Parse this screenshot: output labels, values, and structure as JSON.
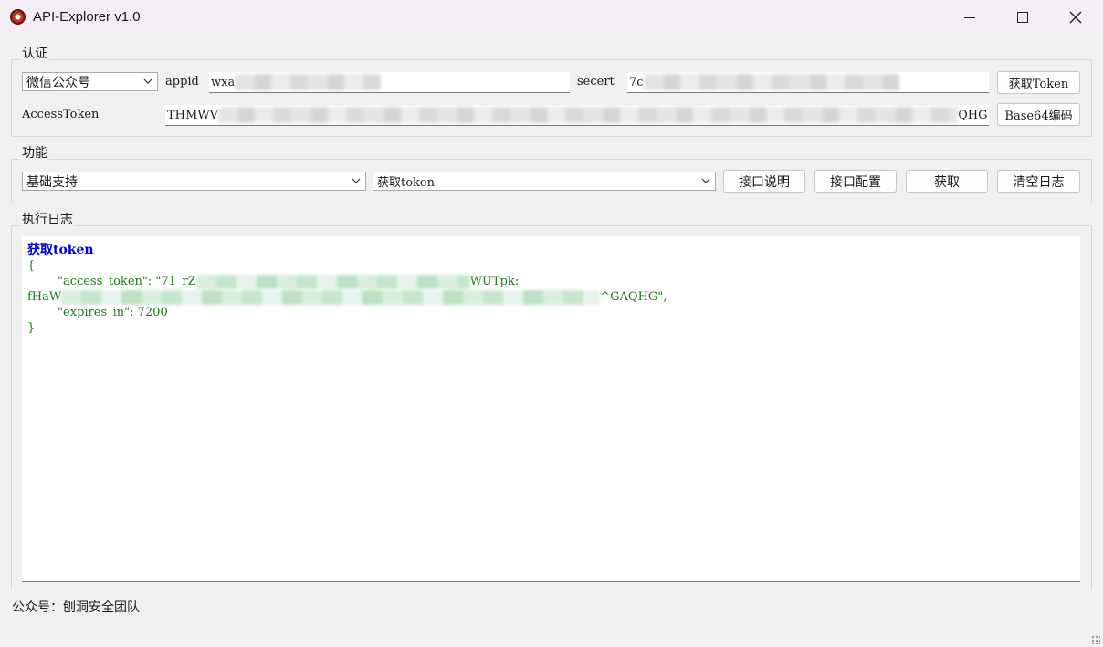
{
  "window": {
    "title": "API-Explorer v1.0",
    "icon": "gear-app-icon"
  },
  "auth": {
    "group_label": "认证",
    "platform_select": "微信公众号",
    "appid_label": "appid",
    "appid_value": "wxa",
    "secret_label": "secert",
    "secret_value": "7c",
    "get_token_label": "获取Token",
    "access_token_label": "AccessToken",
    "access_token_prefix": "THMWV",
    "access_token_suffix": "QHG",
    "base64_label": "Base64编码"
  },
  "func": {
    "group_label": "功能",
    "category_select": "基础支持",
    "api_select": "获取token",
    "api_doc_label": "接口说明",
    "api_config_label": "接口配置",
    "fetch_label": "获取",
    "clear_log_label": "清空日志"
  },
  "log": {
    "group_label": "执行日志",
    "entry_title": "获取token",
    "open_brace": "{",
    "close_brace": "}",
    "line1_prefix": "        \"access_token\": \"71_rZ",
    "line1_tail": "WUTpk:",
    "line2_prefix": "fHaW",
    "line2_suffix": "^GAQHG\",",
    "line3": "        \"expires_in\": 7200"
  },
  "status": {
    "text": "公众号：刨洞安全团队"
  }
}
